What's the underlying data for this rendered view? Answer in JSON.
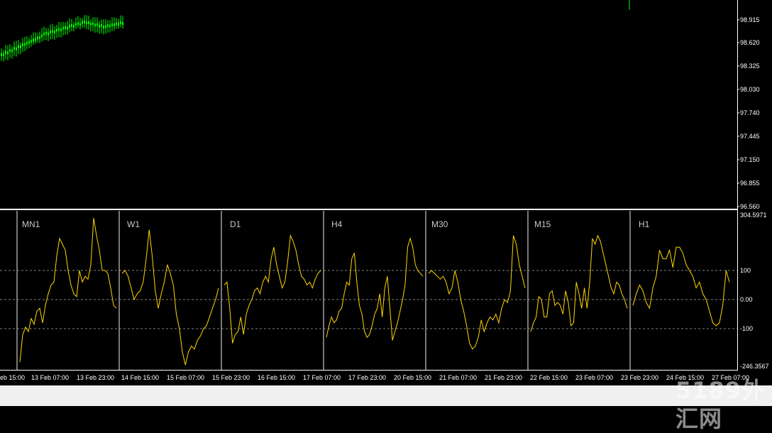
{
  "colors": {
    "background": "#000000",
    "candle": "#00ff00",
    "indicator_line": "#ffd700",
    "grid_level": "#808080",
    "separator": "#a0a0a0",
    "axis_text": "#ffffff"
  },
  "price_axis": {
    "labels": [
      "98.915",
      "98.620",
      "98.325",
      "98.030",
      "97.740",
      "97.445",
      "97.150",
      "96.855",
      "96.560"
    ]
  },
  "indicator_axis": {
    "max_label": "304.5971",
    "level_100": "100",
    "level_0": "0.00",
    "level_neg100": "-100",
    "min_label": "-246.3567"
  },
  "time_axis": {
    "labels": [
      "eb 15:00",
      "13 Feb 07:00",
      "13 Feb 23:00",
      "14 Feb 15:00",
      "15 Feb 07:00",
      "15 Feb 23:00",
      "16 Feb 15:00",
      "17 Feb 07:00",
      "17 Feb 23:00",
      "20 Feb 15:00",
      "21 Feb 07:00",
      "21 Feb 23:00",
      "22 Feb 15:00",
      "23 Feb 07:00",
      "23 Feb 23:00",
      "24 Feb 15:00",
      "27 Feb 07:00"
    ]
  },
  "timeframes": [
    "MN1",
    "W1",
    "D1",
    "H4",
    "M30",
    "M15",
    "H1"
  ],
  "indicator_series": [
    [
      -215,
      -120,
      -95,
      -110,
      -65,
      -85,
      -40,
      -30,
      -80,
      -20,
      20,
      50,
      60,
      150,
      210,
      190,
      170,
      100,
      50,
      20,
      10,
      100,
      60,
      80,
      70,
      120,
      280,
      220,
      170,
      100,
      100,
      90,
      40,
      -20,
      -30
    ],
    [
      90,
      100,
      80,
      40,
      0,
      20,
      30,
      60,
      140,
      240,
      150,
      30,
      -30,
      20,
      60,
      120,
      90,
      50,
      -50,
      -100,
      -180,
      -225,
      -180,
      -160,
      -170,
      -140,
      -125,
      -100,
      -90,
      -60,
      -30,
      0,
      40
    ],
    [
      50,
      60,
      -30,
      -150,
      -120,
      -110,
      -60,
      -120,
      -50,
      -20,
      0,
      30,
      40,
      20,
      60,
      80,
      60,
      140,
      180,
      120,
      80,
      40,
      60,
      130,
      220,
      200,
      170,
      120,
      80,
      70,
      50,
      60,
      40,
      70,
      90,
      100
    ],
    [
      -130,
      -90,
      -60,
      -80,
      -70,
      -40,
      -30,
      20,
      60,
      50,
      140,
      160,
      60,
      -20,
      -50,
      -110,
      -130,
      -120,
      -90,
      -50,
      -30,
      20,
      -60,
      40,
      80,
      -30,
      -140,
      -110,
      -80,
      -40,
      0,
      50,
      180,
      210,
      180,
      120,
      100,
      90,
      80
    ],
    [
      90,
      100,
      90,
      80,
      70,
      80,
      60,
      20,
      40,
      100,
      60,
      0,
      -40,
      -90,
      -150,
      -170,
      -160,
      -130,
      -70,
      -110,
      -80,
      -60,
      -70,
      -50,
      -80,
      -30,
      0,
      -10,
      30,
      220,
      190,
      120,
      80,
      40
    ],
    [
      -110,
      -80,
      -60,
      10,
      0,
      -60,
      -60,
      20,
      30,
      -20,
      -10,
      -20,
      -50,
      30,
      -10,
      -90,
      -80,
      60,
      20,
      -30,
      40,
      -30,
      60,
      210,
      190,
      220,
      200,
      160,
      120,
      80,
      40,
      20,
      60,
      50,
      20,
      0,
      -30
    ],
    [
      -20,
      20,
      50,
      30,
      -10,
      -30,
      40,
      80,
      170,
      140,
      140,
      170,
      110,
      180,
      180,
      160,
      120,
      100,
      80,
      40,
      60,
      20,
      0,
      -40,
      -80,
      -90,
      -80,
      -20,
      100,
      60
    ]
  ]
}
